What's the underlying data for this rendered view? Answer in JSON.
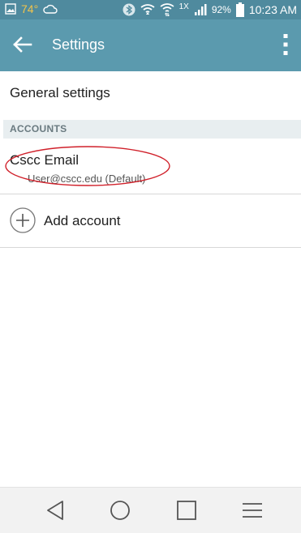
{
  "status_bar": {
    "temperature": "74°",
    "network_type": "1X",
    "battery_percent": "92%",
    "time": "10:23 AM",
    "icons": [
      "image-icon",
      "cloud-icon",
      "bluetooth-icon",
      "wifi-icon",
      "wifi-data-icon",
      "signal-icon",
      "battery-icon"
    ]
  },
  "app_bar": {
    "title": "Settings",
    "back_icon": "back-arrow-icon",
    "overflow_icon": "more-vert-icon",
    "color": "#5b9aae"
  },
  "general": {
    "label": "General settings"
  },
  "accounts_section": {
    "header": "ACCOUNTS",
    "items": [
      {
        "name": "Cscc Email",
        "email": "User@cscc.edu (Default)"
      }
    ],
    "add_label": "Add account",
    "annotation_color": "#d0202a"
  },
  "nav_bar": {
    "icons": [
      "back-triangle-icon",
      "home-circle-icon",
      "recents-square-icon",
      "menu-lines-icon"
    ]
  }
}
